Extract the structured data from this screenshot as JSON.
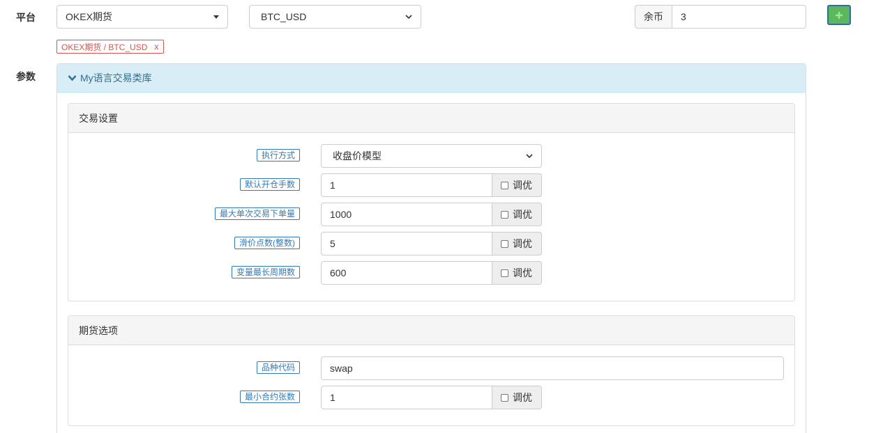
{
  "platform": {
    "label": "平台",
    "exchange": "OKEX期货",
    "pair": "BTC_USD",
    "balance_label": "余币",
    "balance_value": "3",
    "add_icon": "plus-icon",
    "tag": {
      "text": "OKEX期货 / BTC_USD",
      "remove": "x"
    }
  },
  "params": {
    "label": "参数",
    "library": {
      "title": "My语言交易类库",
      "icon": "chevron-down-icon"
    },
    "trade_settings": {
      "title": "交易设置",
      "exec_mode": {
        "label": "执行方式",
        "value": "收盘价模型"
      },
      "fields": [
        {
          "label": "默认开仓手数",
          "value": "1",
          "tune": "调优"
        },
        {
          "label": "最大单次交易下单量",
          "value": "1000",
          "tune": "调优"
        },
        {
          "label": "滑价点数(整数)",
          "value": "5",
          "tune": "调优"
        },
        {
          "label": "变量最长周期数",
          "value": "600",
          "tune": "调优"
        }
      ]
    },
    "futures_options": {
      "title": "期货选项",
      "symbol": {
        "label": "品种代码",
        "value": "swap"
      },
      "min_contract": {
        "label": "最小合约张数",
        "value": "1",
        "tune": "调优"
      }
    }
  },
  "colors": {
    "accent_blue": "#337ab7",
    "danger_red": "#d9534f",
    "success_green": "#5cb85c",
    "info_bg": "#d9edf7"
  }
}
